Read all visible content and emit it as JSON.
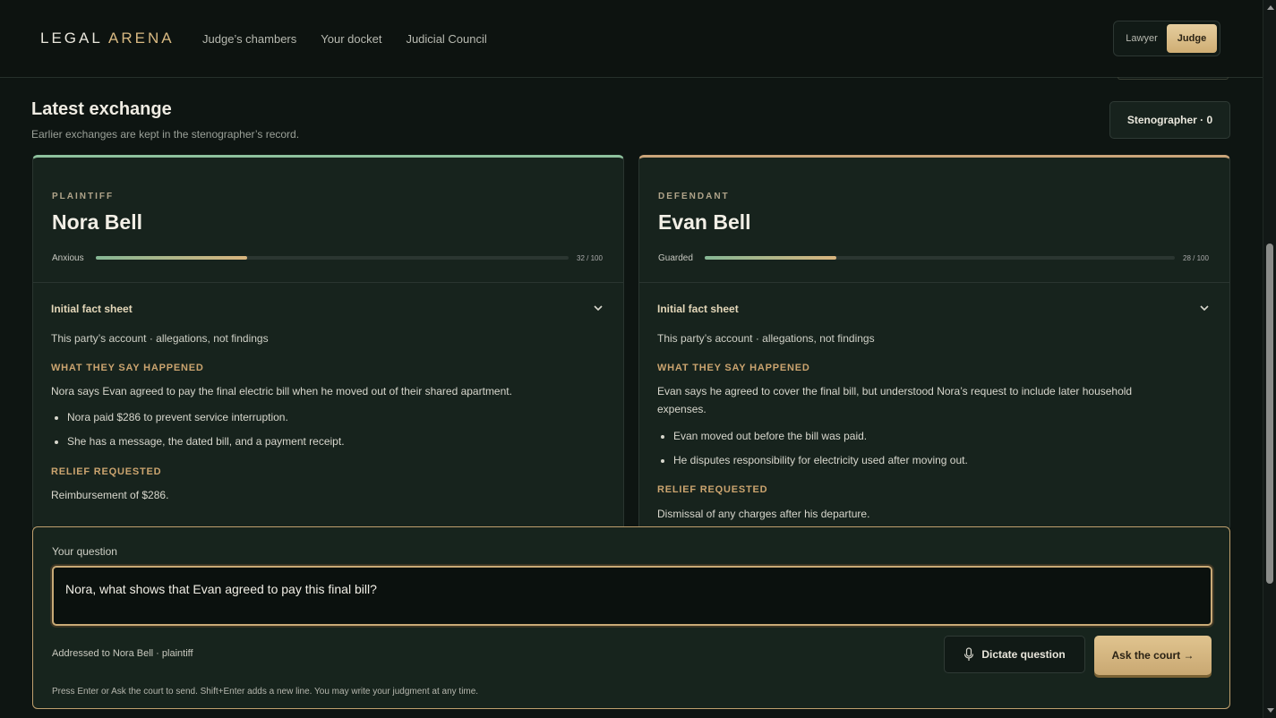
{
  "app": {
    "logo_main": "LEGAL",
    "logo_accent": "ARENA"
  },
  "nav": {
    "items": [
      "Judge’s chambers",
      "Your docket",
      "Judicial Council"
    ]
  },
  "role_toggle": {
    "lawyer": "Lawyer",
    "judge": "Judge",
    "selected": "Judge"
  },
  "section": {
    "title": "Latest exchange",
    "subtitle": "Earlier exchanges are kept in the stenographer’s record.",
    "steno_button": "Stenographer · 0"
  },
  "plaintiff": {
    "role": "PLAINTIFF",
    "name": "Nora Bell",
    "mood": "Anxious",
    "mood_value": 32,
    "mood_score": "32 / 100",
    "sheet_title": "Initial fact sheet",
    "sheet_sub": "This party’s account · allegations, not findings",
    "happened_head": "WHAT THEY SAY HAPPENED",
    "happened_text": "Nora says Evan agreed to pay the final electric bill when he moved out of their shared apartment.",
    "bullets": [
      "Nora paid $286 to prevent service interruption.",
      "She has a message, the dated bill, and a payment receipt."
    ],
    "relief_head": "RELIEF REQUESTED",
    "relief_text": "Reimbursement of $286."
  },
  "defendant": {
    "role": "DEFENDANT",
    "name": "Evan Bell",
    "mood": "Guarded",
    "mood_value": 28,
    "mood_score": "28 / 100",
    "sheet_title": "Initial fact sheet",
    "sheet_sub": "This party’s account · allegations, not findings",
    "happened_head": "WHAT THEY SAY HAPPENED",
    "happened_text_line1": "Evan says he agreed to cover the final bill, but understood Nora’s request to include later household",
    "happened_text_line2": "expenses.",
    "bullets": [
      "Evan moved out before the bill was paid.",
      "He disputes responsibility for electricity used after moving out."
    ],
    "relief_head": "RELIEF REQUESTED",
    "relief_text": "Dismissal of any charges after his departure."
  },
  "question": {
    "label": "Your question",
    "value": "Nora, what shows that Evan agreed to pay this final bill?",
    "addressed_to": "Addressed to Nora Bell · plaintiff",
    "dictate_button": "Dictate question",
    "ask_button": "Ask the court →",
    "hint": "Press Enter or Ask the court to send. Shift+Enter adds a new line. You may write your judgment at any time."
  },
  "colors": {
    "accent_gold": "#d8b982",
    "plaintiff_accent": "#8ec19d",
    "defendant_accent": "#caa57a",
    "background": "#0e1512"
  }
}
